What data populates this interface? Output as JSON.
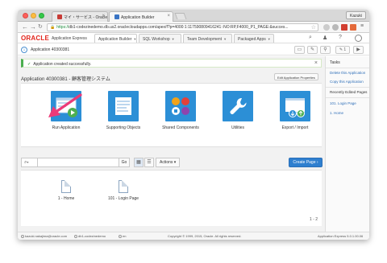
{
  "browser": {
    "tabs": [
      {
        "label": "マイ・サービス - Oracle ..."
      },
      {
        "label": "Application Builder"
      }
    ],
    "user": "Kazuki",
    "url_prefix": "https://",
    "url_rest": "db1-codezinedemo.db.us2.oraclecloudapps.com/apex/f?p=4000:1:117590809416241::NO:RP,F4000_P1_PAGE:&succes..."
  },
  "apex_header": {
    "brand": "ORACLE",
    "product": "Application Express",
    "menu_tabs": [
      {
        "label": "Application Builder"
      },
      {
        "label": "SQL Workshop"
      },
      {
        "label": "Team Development"
      },
      {
        "label": "Packaged Apps"
      }
    ]
  },
  "toolbar": {
    "app_number": "1",
    "app_label": "Application 40300381",
    "edit_badge": "1"
  },
  "main": {
    "success_message": "Application created successfully.",
    "app_title": "Application 40300381 - 顧客管理システム",
    "edit_props": "Edit Application Properties",
    "tiles": [
      {
        "label": "Run Application"
      },
      {
        "label": "Supporting Objects"
      },
      {
        "label": "Shared Components"
      },
      {
        "label": "Utilities"
      },
      {
        "label": "Export / Import"
      }
    ],
    "search": {
      "go": "Go",
      "actions": "Actions",
      "create": "Create Page"
    },
    "pages": [
      {
        "label": "1 - Home"
      },
      {
        "label": "101 - Login Page"
      }
    ],
    "pager": "1 - 2"
  },
  "sidebar": {
    "tasks_title": "Tasks",
    "tasks": [
      {
        "label": "Delete this Application"
      },
      {
        "label": "Copy this Application"
      }
    ],
    "recent_title": "Recently Edited Pages",
    "recent": [
      {
        "label": "101. Login Page"
      },
      {
        "label": "1. Home"
      }
    ]
  },
  "statusbar": {
    "user_email": "kazuki.nakajima@oracle.com",
    "database": "db1-codezinedemo",
    "language": "en",
    "copyright": "Copyright © 1999, 2015, Oracle. All rights reserved.",
    "version": "Application Express 5.0.1.00.06"
  },
  "colors": {
    "oracle_red": "#e2241b",
    "tile_blue": "#2c8fd6",
    "create_blue": "#2f7fcf",
    "success_green": "#4caf50",
    "arrow_pink": "#ec3a78"
  }
}
